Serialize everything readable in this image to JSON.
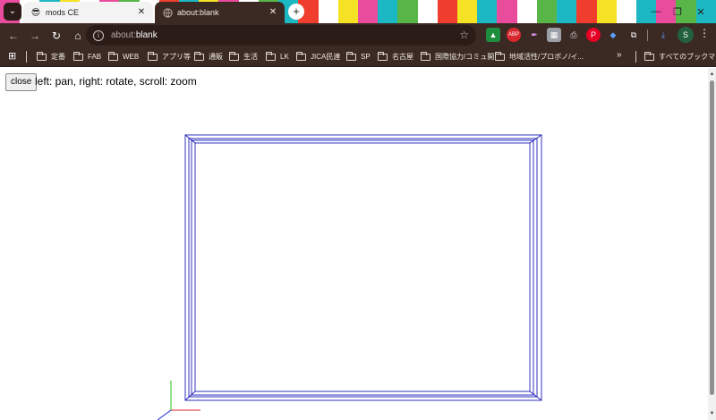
{
  "tabs": [
    {
      "title": "mods CE",
      "active": true
    },
    {
      "title": "about:blank",
      "active": false
    }
  ],
  "address_bar": {
    "scheme": "about:",
    "path": "blank"
  },
  "profile_initial": "S",
  "bookmarks": [
    {
      "label": "定番"
    },
    {
      "label": "FAB"
    },
    {
      "label": "WEB"
    },
    {
      "label": "アプリ等"
    },
    {
      "label": "通販"
    },
    {
      "label": "生活"
    },
    {
      "label": "LK"
    },
    {
      "label": "JICA民連"
    },
    {
      "label": "SP"
    },
    {
      "label": "名古屋"
    },
    {
      "label": "国際協力/コミュ開"
    },
    {
      "label": "地域活性/プロボノ/イ..."
    }
  ],
  "all_bookmarks_label": "すべてのブックマーク",
  "page": {
    "close_label": "close",
    "hint": "left: pan, right: rotate, scroll: zoom"
  },
  "viewer": {
    "line_color": "#1a1ab8",
    "axis_x_color": "#e02020",
    "axis_y_color": "#20c020",
    "axis_z_color": "#2020e0"
  },
  "stripe_colors": [
    "#e94b9d",
    "#ffffff",
    "#1bb8c4",
    "#f5e224",
    "#ffffff",
    "#e94b9d",
    "#58b648",
    "#ffffff",
    "#ef3e2d",
    "#1bb8c4",
    "#f5e224",
    "#e94b9d",
    "#ffffff",
    "#58b648",
    "#1bb8c4",
    "#ef3e2d",
    "#ffffff",
    "#f5e224",
    "#e94b9d",
    "#1bb8c4",
    "#58b648",
    "#ffffff",
    "#ef3e2d",
    "#f5e224",
    "#1bb8c4",
    "#e94b9d",
    "#ffffff",
    "#58b648",
    "#1bb8c4",
    "#ef3e2d",
    "#f5e224",
    "#ffffff",
    "#1bb8c4",
    "#e94b9d",
    "#58b648",
    "#1bb8c4"
  ]
}
